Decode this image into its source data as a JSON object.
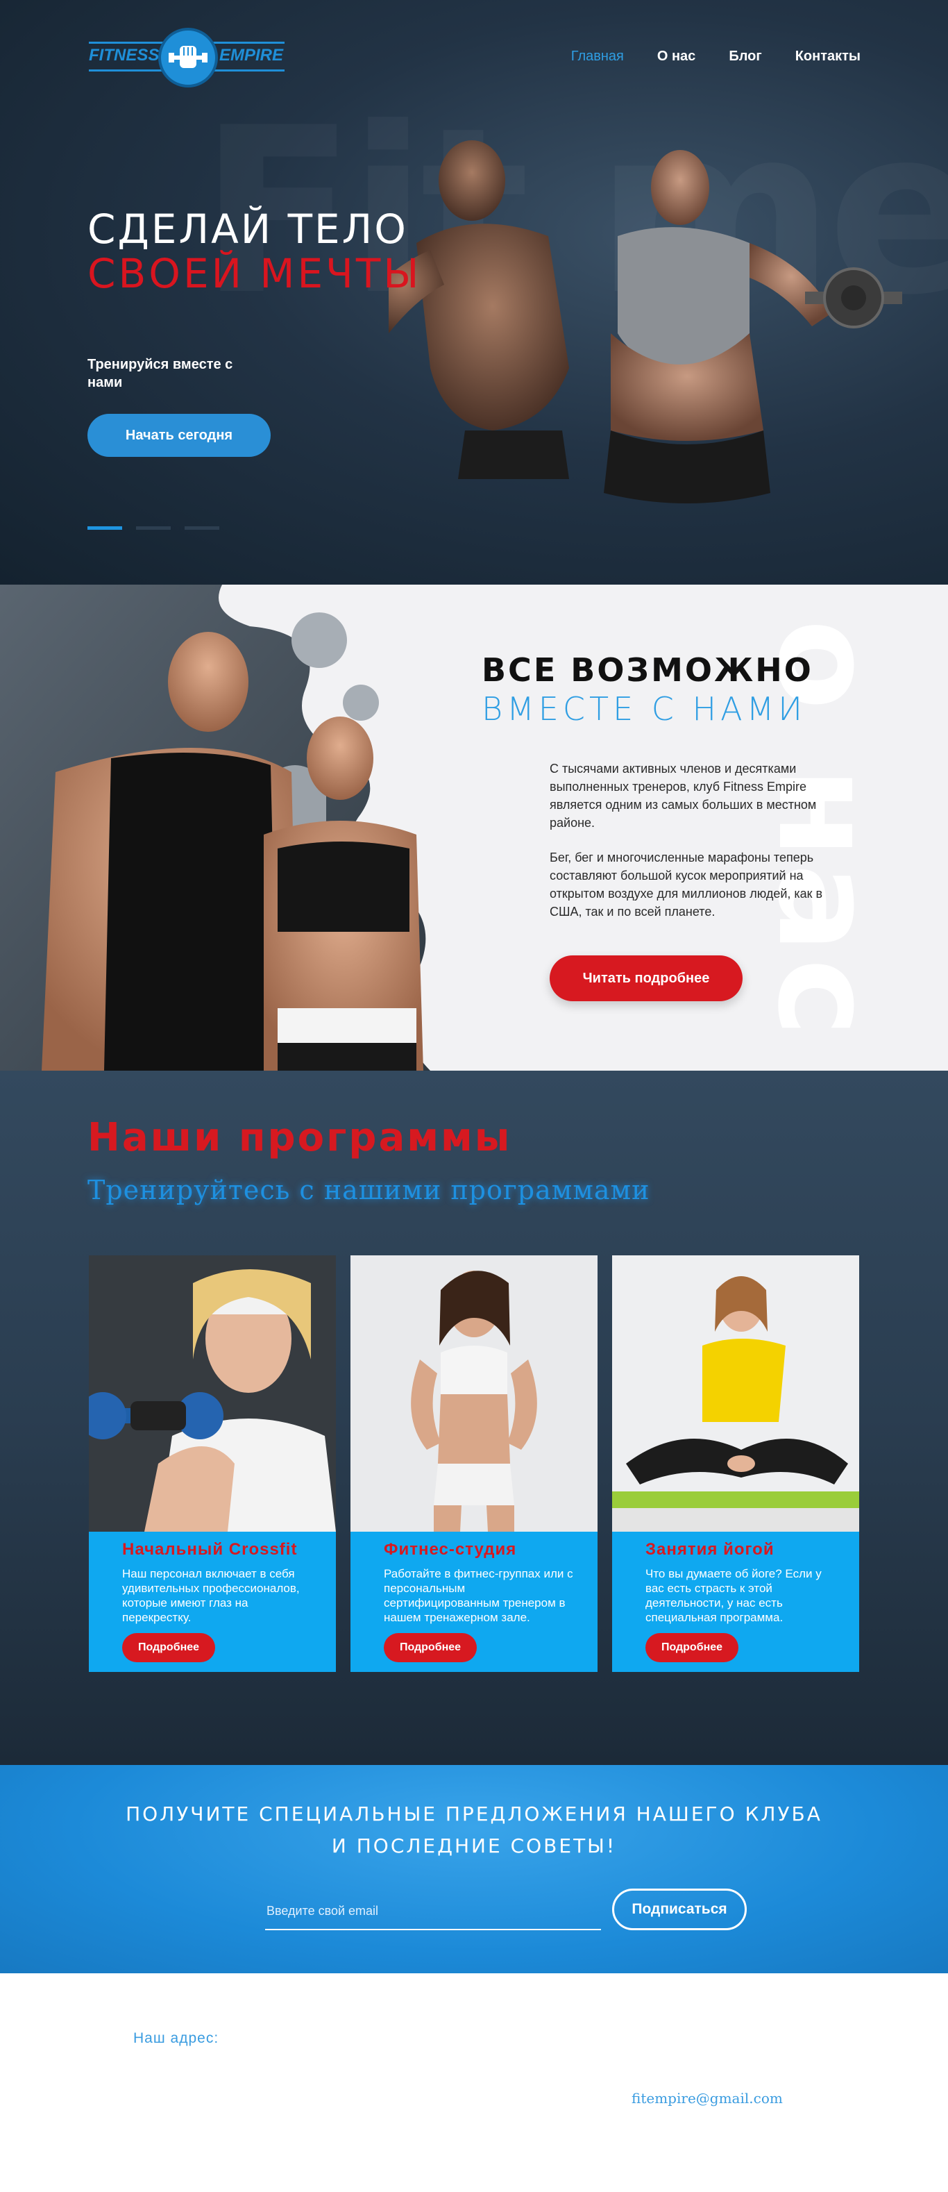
{
  "logo": {
    "left_text": "FITNESS",
    "right_text": "EMPIRE"
  },
  "nav": {
    "items": [
      "Главная",
      "О нас",
      "Блог",
      "Контакты"
    ],
    "active_index": 0
  },
  "hero": {
    "title_line1": "СДЕЛАЙ ТЕЛО",
    "title_line2": "СВОЕЙ МЕЧТЫ",
    "subtitle": "Тренируйся вместе с нами",
    "cta_label": "Начать сегодня",
    "slides_total": 3,
    "slide_active": 1
  },
  "about": {
    "heading1": "ВСЕ ВОЗМОЖНО",
    "heading2": "ВМЕСТЕ С НАМИ",
    "watermark": "о нас",
    "paragraph1": "С тысячами активных членов и десятками выполненных тренеров, клуб Fitness Empire является одним из самых больших в местном районе.",
    "paragraph2": "Бег, бег и многочисленные марафоны теперь составляют большой кусок мероприятий на открытом воздухе для миллионов людей, как в США, так и по всей планете.",
    "button_label": "Читать подробнее"
  },
  "programs": {
    "heading": "Наши программы",
    "subheading": "Тренируйтесь с нашими программами",
    "cards": [
      {
        "title": "Начальный Crossfit",
        "text": "Наш персонал включает в себя удивительных профессионалов, которые имеют глаз на перекрестку.",
        "button": "Подробнее"
      },
      {
        "title": "Фитнес-студия",
        "text": "Работайте в фитнес-группах или с персональным сертифицированным тренером в нашем тренажерном зале.",
        "button": "Подробнее"
      },
      {
        "title": "Занятия йогой",
        "text": "Что вы думаете об йоге? Если у вас есть страсть к этой деятельности, у нас есть специальная программа.",
        "button": "Подробнее"
      }
    ]
  },
  "subscribe": {
    "heading_line1": "ПОЛУЧИТЕ СПЕЦИАЛЬНЫЕ ПРЕДЛОЖЕНИЯ НАШЕГО КЛУБА",
    "heading_line2": "И ПОСЛЕДНИЕ СОВЕТЫ!",
    "email_placeholder": "Введите свой email",
    "button_label": "Подписаться"
  },
  "footer": {
    "address_label": "Наш адрес:",
    "email": "fitempire@gmail.com"
  },
  "colors": {
    "accent_blue": "#2f9ee3",
    "accent_red": "#d71920",
    "card_blue": "#0fa8f0",
    "dark_navy": "#1c2a38"
  }
}
